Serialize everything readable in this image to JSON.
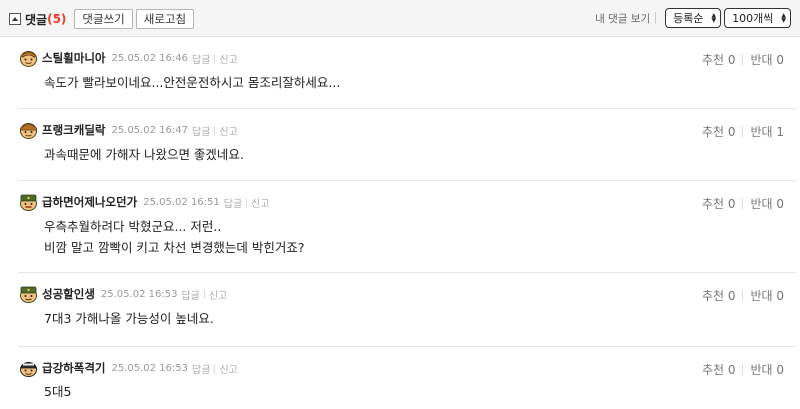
{
  "header": {
    "title": "댓글",
    "count": "(5)",
    "write_button": "댓글쓰기",
    "refresh_button": "새로고침",
    "my_comments": "내 댓글 보기",
    "sort_select": "등록순",
    "per_page_select": "100개씩"
  },
  "comments": [
    {
      "nickname": "스틸휠마니아",
      "date": "25.05.02 16:46",
      "reply": "답글",
      "report": "신고",
      "lines": [
        "속도가 빨라보이네요...안전운전하시고 몸조리잘하세요..."
      ],
      "recommend": "추천 0",
      "oppose": "반대 0"
    },
    {
      "nickname": "프랭크캐딜락",
      "date": "25.05.02 16:47",
      "reply": "답글",
      "report": "신고",
      "lines": [
        "과속때문에 가해자 나왔으면 좋겠네요."
      ],
      "recommend": "추천 0",
      "oppose": "반대 1"
    },
    {
      "nickname": "급하면어제나오던가",
      "date": "25.05.02 16:51",
      "reply": "답글",
      "report": "신고",
      "lines": [
        "우측추월하려다 박혔군요... 저런..",
        "비깜 말고 깜빡이 키고 차선 변경했는데 박힌거죠?"
      ],
      "recommend": "추천 0",
      "oppose": "반대 0"
    },
    {
      "nickname": "성공할인생",
      "date": "25.05.02 16:53",
      "reply": "답글",
      "report": "신고",
      "lines": [
        "7대3 가해나올 가능성이 높네요."
      ],
      "recommend": "추천 0",
      "oppose": "반대 0"
    },
    {
      "nickname": "급강하폭격기",
      "date": "25.05.02 16:53",
      "reply": "답글",
      "report": "신고",
      "lines": [
        "5대5"
      ],
      "recommend": "추천 0",
      "oppose": "반대 0"
    }
  ]
}
